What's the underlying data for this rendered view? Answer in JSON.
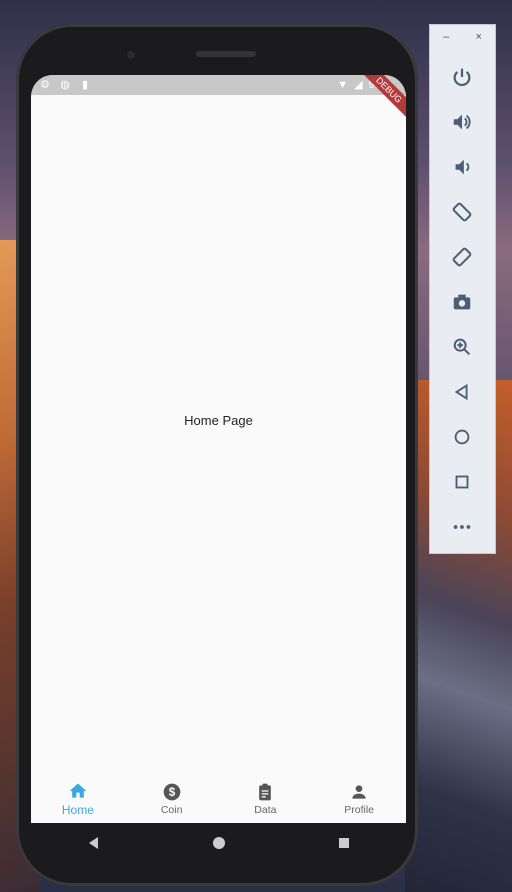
{
  "status_bar": {
    "time": "9:03",
    "debug_ribbon": "DEBUG"
  },
  "main": {
    "center_text": "Home Page"
  },
  "bottom_nav": {
    "items": [
      {
        "label": "Home",
        "icon": "home-icon",
        "active": true
      },
      {
        "label": "Coin",
        "icon": "dollar-icon",
        "active": false
      },
      {
        "label": "Data",
        "icon": "clipboard-icon",
        "active": false
      },
      {
        "label": "Profile",
        "icon": "person-icon",
        "active": false
      }
    ]
  },
  "emulator_toolbar": {
    "minimize_label": "–",
    "close_label": "×",
    "buttons": [
      "power-icon",
      "volume-up-icon",
      "volume-down-icon",
      "rotate-left-icon",
      "rotate-right-icon",
      "camera-icon",
      "zoom-icon",
      "back-icon",
      "home-circle-icon",
      "overview-icon",
      "more-icon"
    ]
  },
  "colors": {
    "accent": "#3aa9e0",
    "inactive": "#666666",
    "toolbar_icon": "#4b5e75"
  }
}
